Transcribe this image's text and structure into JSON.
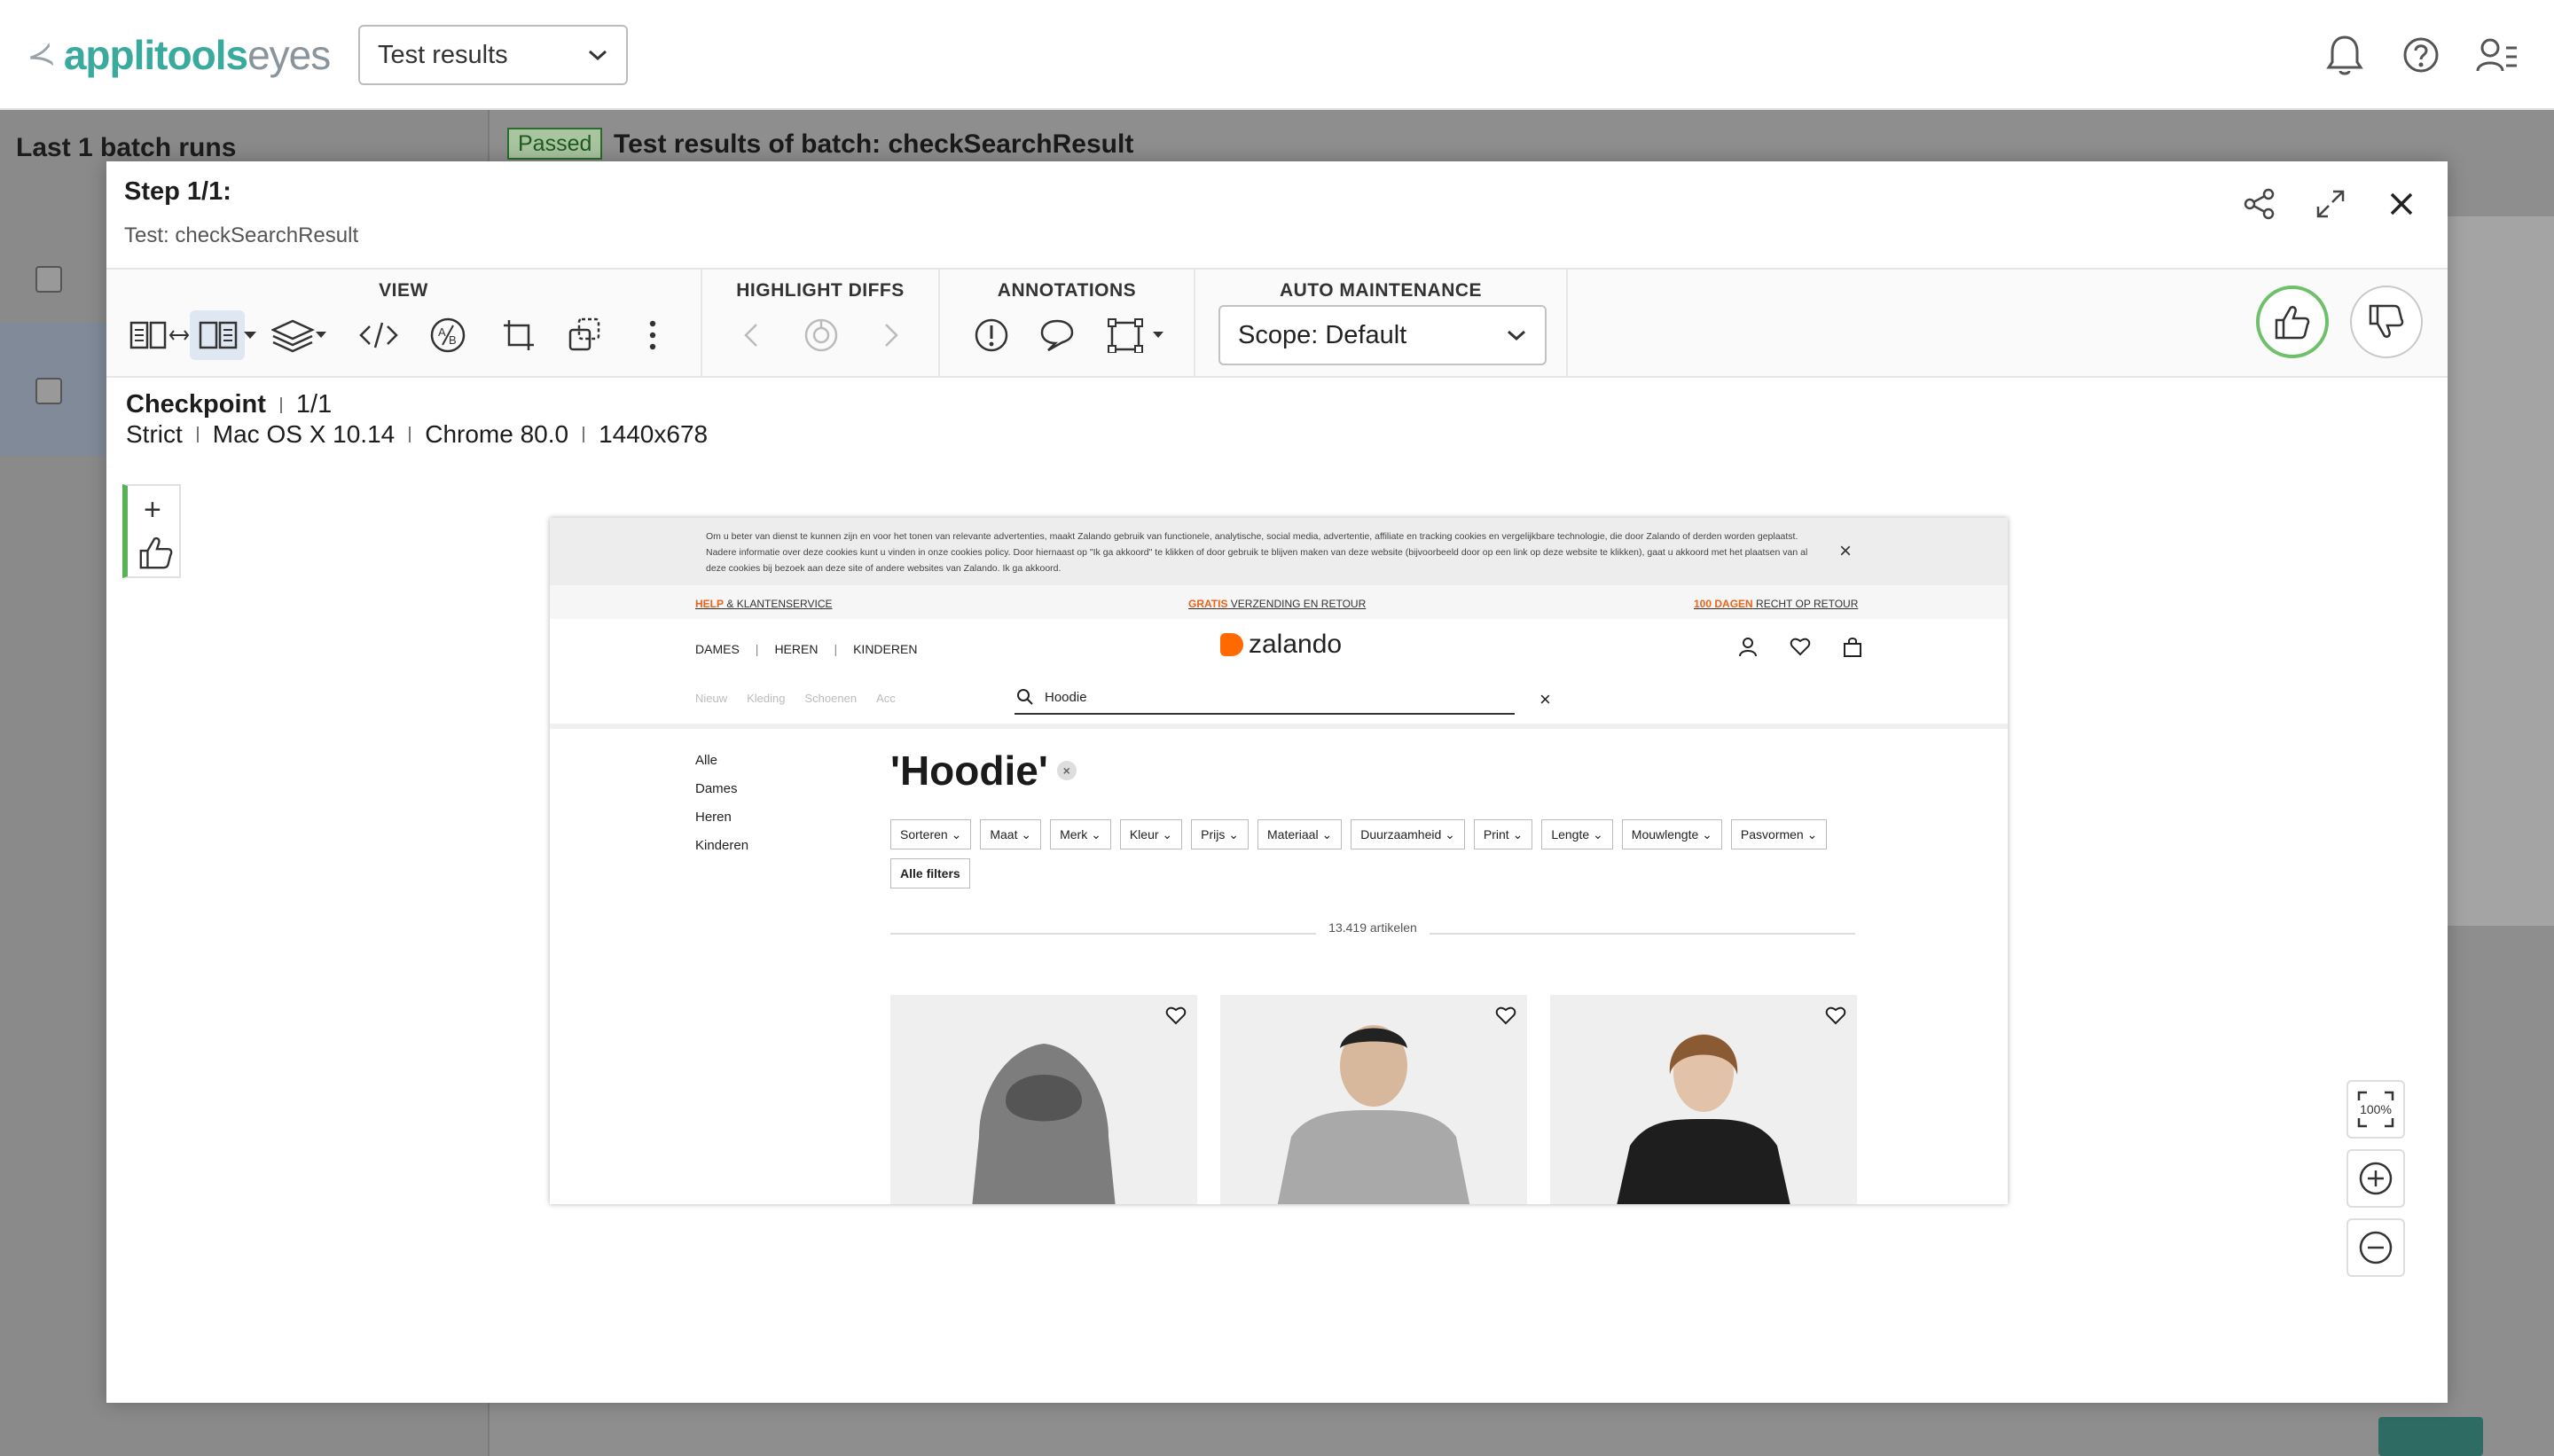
{
  "app": {
    "logo_primary": "applitools",
    "logo_secondary": "eyes",
    "view_select": "Test results"
  },
  "background": {
    "left_title": "Last 1 batch runs",
    "status_badge": "Passed",
    "batch_title": "Test results of batch: checkSearchResult"
  },
  "modal": {
    "step_title": "Step 1/1:",
    "test_name": "Test: checkSearchResult",
    "toolbar": {
      "view_label": "VIEW",
      "highlight_label": "HIGHLIGHT DIFFS",
      "annotations_label": "ANNOTATIONS",
      "auto_label": "AUTO MAINTENANCE",
      "scope_value": "Scope: Default"
    },
    "checkpoint": {
      "name": "Checkpoint",
      "index": "1/1",
      "match_level": "Strict",
      "os": "Mac OS X 10.14",
      "browser": "Chrome 80.0",
      "viewport": "1440x678"
    }
  },
  "screenshot": {
    "cookie_text": "Om u beter van dienst te kunnen zijn en voor het tonen van relevante advertenties, maakt Zalando gebruik van functionele, analytische, social media, advertentie, affiliate en tracking cookies en vergelijkbare technologie, die door Zalando of derden worden geplaatst. Nadere informatie over deze cookies kunt u vinden in onze cookies policy. Door hiernaast op \"Ik ga akkoord\" te klikken of door gebruik te blijven maken van deze website (bijvoorbeeld door op een link op deze website te klikken), gaat u akkoord met het plaatsen van al deze cookies bij bezoek aan deze site of andere websites van Zalando. Ik ga akkoord.",
    "promo": {
      "left_hl": "HELP",
      "left": " & KLANTENSERVICE",
      "mid_hl": "GRATIS",
      "mid": " VERZENDING EN RETOUR",
      "right_hl": "100 DAGEN",
      "right": " RECHT OP RETOUR"
    },
    "nav": [
      "DAMES",
      "HEREN",
      "KINDEREN"
    ],
    "brand": "zalando",
    "categories": [
      "Nieuw",
      "Kleding",
      "Schoenen",
      "Acc"
    ],
    "search_value": "Hoodie",
    "side_categories": [
      "Alle",
      "Dames",
      "Heren",
      "Kinderen"
    ],
    "heading": "'Hoodie'",
    "filters_row1": [
      "Sorteren",
      "Maat",
      "Merk",
      "Kleur",
      "Prijs",
      "Materiaal",
      "Duurzaamheid",
      "Print",
      "Lengte"
    ],
    "filters_row2": [
      "Mouwlengte",
      "Pasvormen"
    ],
    "all_filters": "Alle filters",
    "count": "13.419 artikelen"
  },
  "zoom": {
    "fit_label": "100%"
  }
}
